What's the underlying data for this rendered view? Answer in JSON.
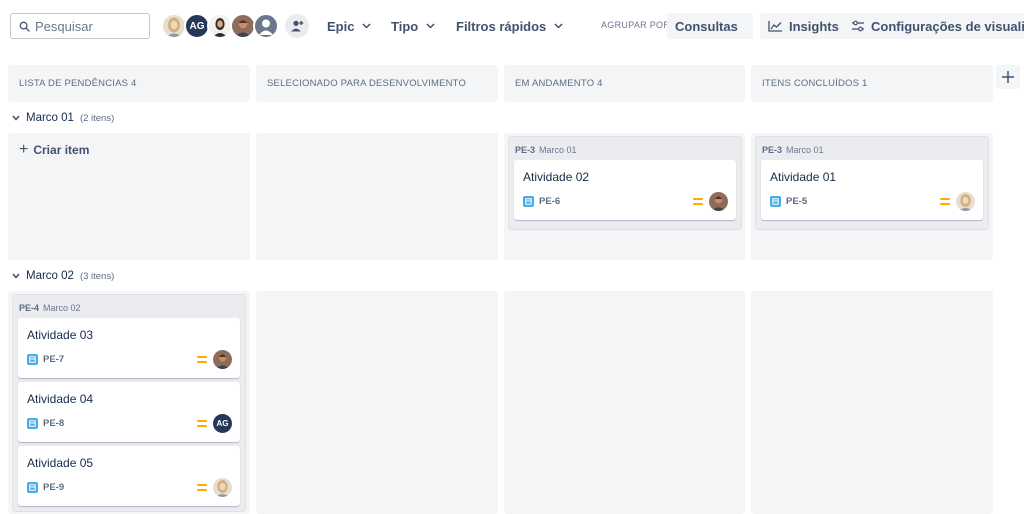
{
  "toolbar": {
    "search_placeholder": "Pesquisar",
    "avatars": [
      {
        "kind": "photo-woman-blonde",
        "initials": ""
      },
      {
        "kind": "initials",
        "initials": "AG"
      },
      {
        "kind": "photo-woman-dark",
        "initials": ""
      },
      {
        "kind": "photo-man",
        "initials": ""
      },
      {
        "kind": "default-user",
        "initials": ""
      }
    ],
    "filters": [
      {
        "label": "Epic"
      },
      {
        "label": "Tipo"
      },
      {
        "label": "Filtros rápidos"
      }
    ],
    "group_by_label": "AGRUPAR POR",
    "group_by_value": "Consultas",
    "insights_label": "Insights",
    "view_settings_label": "Configurações de visualização"
  },
  "columns": [
    {
      "title": "LISTA DE PENDÊNCIAS 4"
    },
    {
      "title": "SELECIONADO PARA DESENVOLVIMENTO"
    },
    {
      "title": "EM ANDAMENTO 4"
    },
    {
      "title": "ITENS CONCLUÍDOS 1"
    }
  ],
  "swimlanes": [
    {
      "name": "Marco 01",
      "count": "(2 itens)",
      "create_label": "Criar item"
    },
    {
      "name": "Marco 02",
      "count": "(3 itens)"
    }
  ],
  "groups": {
    "g1": {
      "key": "PE-3",
      "summary": "Marco 01",
      "cards": [
        {
          "title": "Atividade 02",
          "key": "PE-6",
          "assignee": "photo-man"
        }
      ]
    },
    "g2": {
      "key": "PE-3",
      "summary": "Marco 01",
      "cards": [
        {
          "title": "Atividade 01",
          "key": "PE-5",
          "assignee": "photo-woman-blonde"
        }
      ]
    },
    "g3": {
      "key": "PE-4",
      "summary": "Marco 02",
      "cards": [
        {
          "title": "Atividade 03",
          "key": "PE-7",
          "assignee": "photo-man"
        },
        {
          "title": "Atividade 04",
          "key": "PE-8",
          "assignee": "AG"
        },
        {
          "title": "Atividade 05",
          "key": "PE-9",
          "assignee": "photo-woman-blonde"
        }
      ]
    }
  },
  "colors": {
    "priority_medium": "#ffab00",
    "story_icon": "#4bade8",
    "column_bg": "#f4f5f7",
    "avatar_initials_bg": "#253858"
  }
}
